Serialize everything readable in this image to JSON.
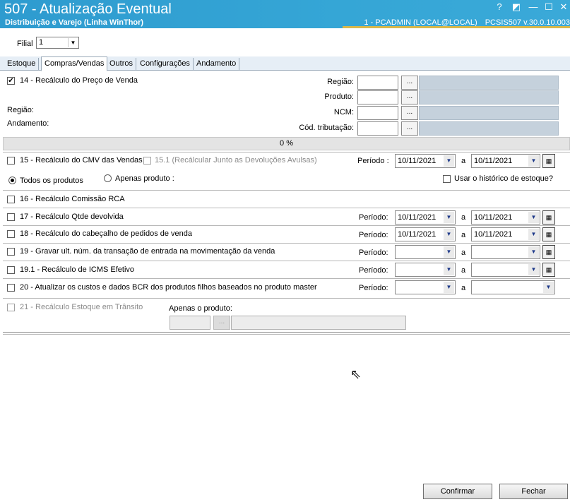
{
  "window": {
    "title": "507 - Atualização Eventual",
    "subtitle": "Distribuição e Varejo (Linha WinThor)",
    "user": "1 - PCADMIN (LOCAL@LOCAL)",
    "version": "PCSIS507  v.30.0.10.003",
    "controls": {
      "help": "?",
      "restore_small": "◩",
      "minimize": "—",
      "maximize": "☐",
      "close": "✕"
    }
  },
  "filial": {
    "label": "Filial",
    "value": "1"
  },
  "tabs": [
    {
      "label": "Estoque"
    },
    {
      "label": "Compras/Vendas"
    },
    {
      "label": "Outros"
    },
    {
      "label": "Configurações"
    },
    {
      "label": "Andamento"
    }
  ],
  "section14": {
    "label": "14 - Recálculo do Preço de Venda",
    "checked": true,
    "regiao_left": "Região:",
    "andamento": "Andamento:",
    "fields": [
      {
        "label": "Região:"
      },
      {
        "label": "Produto:"
      },
      {
        "label": "NCM:"
      },
      {
        "label": "Cód. tributação:"
      }
    ],
    "dots": "..."
  },
  "progress": {
    "text": "0 %"
  },
  "row15": {
    "label": "15 - Recálculo do CMV das Vendas",
    "sub_label": "15.1 (Recálcular Junto as Devoluções Avulsas)",
    "periodo_label": "Período :",
    "date_from": "10/11/2021",
    "a": "a",
    "date_to": "10/11/2021",
    "radio_all": "Todos os produtos",
    "radio_one": "Apenas produto :",
    "usar_historico": "Usar o histórico de estoque?"
  },
  "row16": {
    "label": "16 - Recálculo Comissão RCA"
  },
  "row17": {
    "label": "17 - Recálculo Qtde devolvida",
    "periodo": "Período:",
    "date_from": "10/11/2021",
    "a": "a",
    "date_to": "10/11/2021"
  },
  "row18": {
    "label": "18 - Recálculo do cabeçalho de pedidos de venda",
    "periodo": "Período:",
    "date_from": "10/11/2021",
    "a": "a",
    "date_to": "10/11/2021"
  },
  "row19": {
    "label": "19 - Gravar ult. núm. da transação de entrada na movimentação da venda",
    "periodo": "Período:",
    "a": "a"
  },
  "row191": {
    "label": "19.1 - Recálculo de ICMS Efetivo",
    "periodo": "Período:",
    "a": "a"
  },
  "row20": {
    "label": "20 - Atualizar os custos e dados BCR dos produtos filhos baseados no produto master",
    "periodo": "Período:",
    "a": "a"
  },
  "row21": {
    "label": "21 - Recálculo Estoque em Trânsito",
    "apenas": "Apenas o produto:",
    "dots": "..."
  },
  "buttons": {
    "confirmar": "Confirmar",
    "fechar": "Fechar"
  },
  "icons": {
    "dropdown": "triangle-down",
    "calendar": "calendar-icon"
  }
}
